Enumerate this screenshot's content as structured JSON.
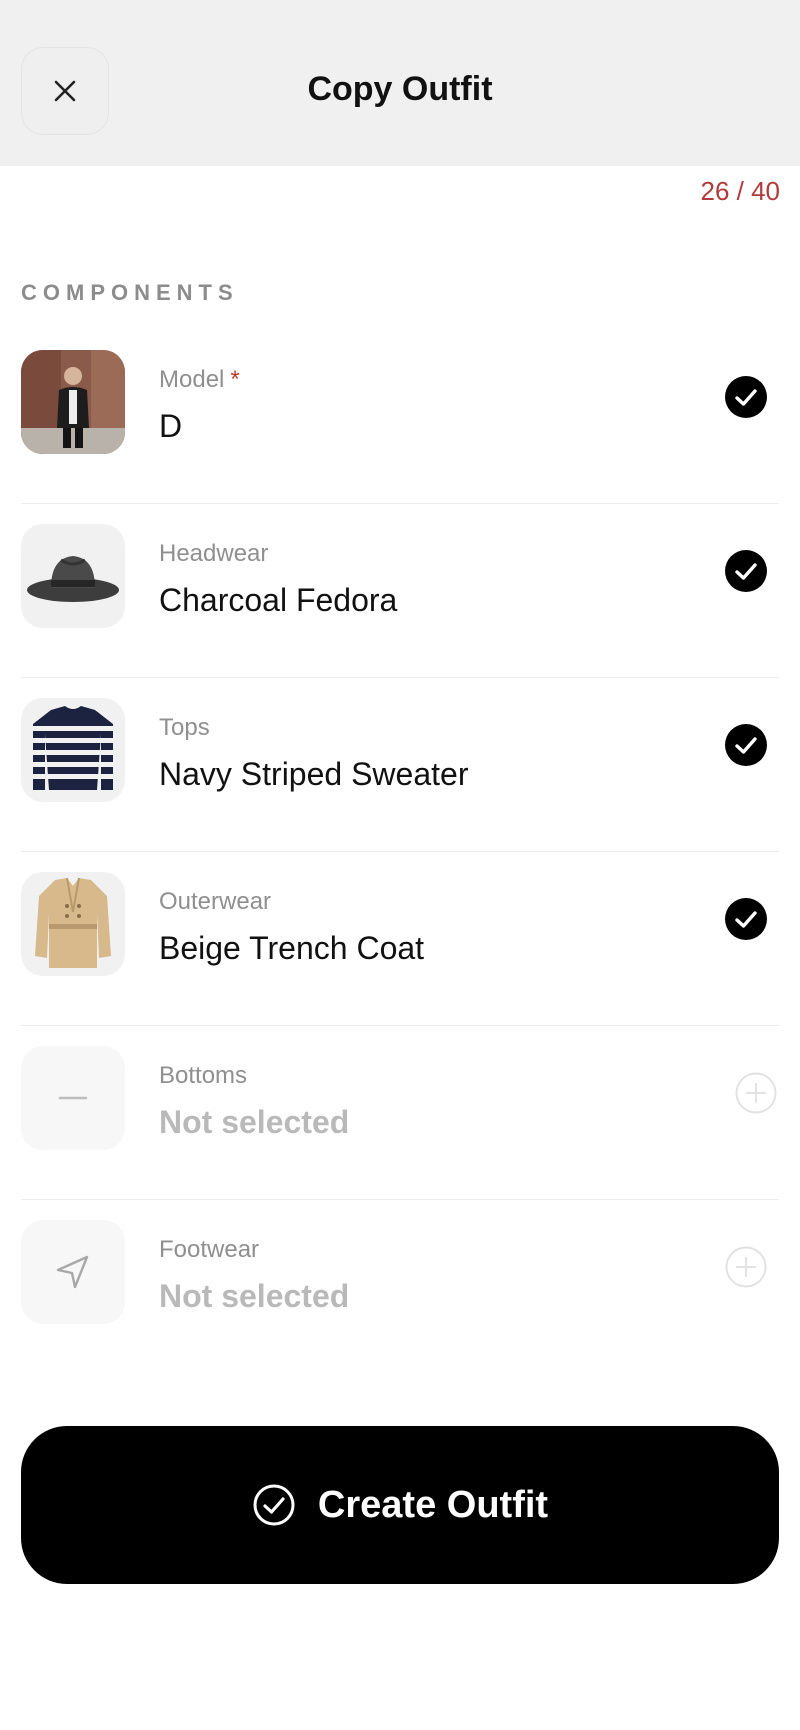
{
  "header": {
    "title": "Copy Outfit"
  },
  "counter": "26 / 40",
  "section_label": "COMPONENTS",
  "components": [
    {
      "category": "Model",
      "required": "*",
      "value": "D",
      "status": "selected",
      "icon": "model-photo"
    },
    {
      "category": "Headwear",
      "value": "Charcoal Fedora",
      "status": "selected",
      "icon": "fedora-hat"
    },
    {
      "category": "Tops",
      "value": "Navy Striped Sweater",
      "status": "selected",
      "icon": "striped-sweater"
    },
    {
      "category": "Outerwear",
      "value": "Beige Trench Coat",
      "status": "selected",
      "icon": "trench-coat"
    },
    {
      "category": "Bottoms",
      "value": "Not selected",
      "status": "empty",
      "icon": "minus-icon"
    },
    {
      "category": "Footwear",
      "value": "Not selected",
      "status": "empty",
      "icon": "send-arrow-icon"
    }
  ],
  "cta": {
    "label": "Create Outfit",
    "icon": "check-circle-icon"
  },
  "colors": {
    "accent": "#000000",
    "counter": "#b23a3a",
    "header_bg": "#f0f0f0"
  }
}
